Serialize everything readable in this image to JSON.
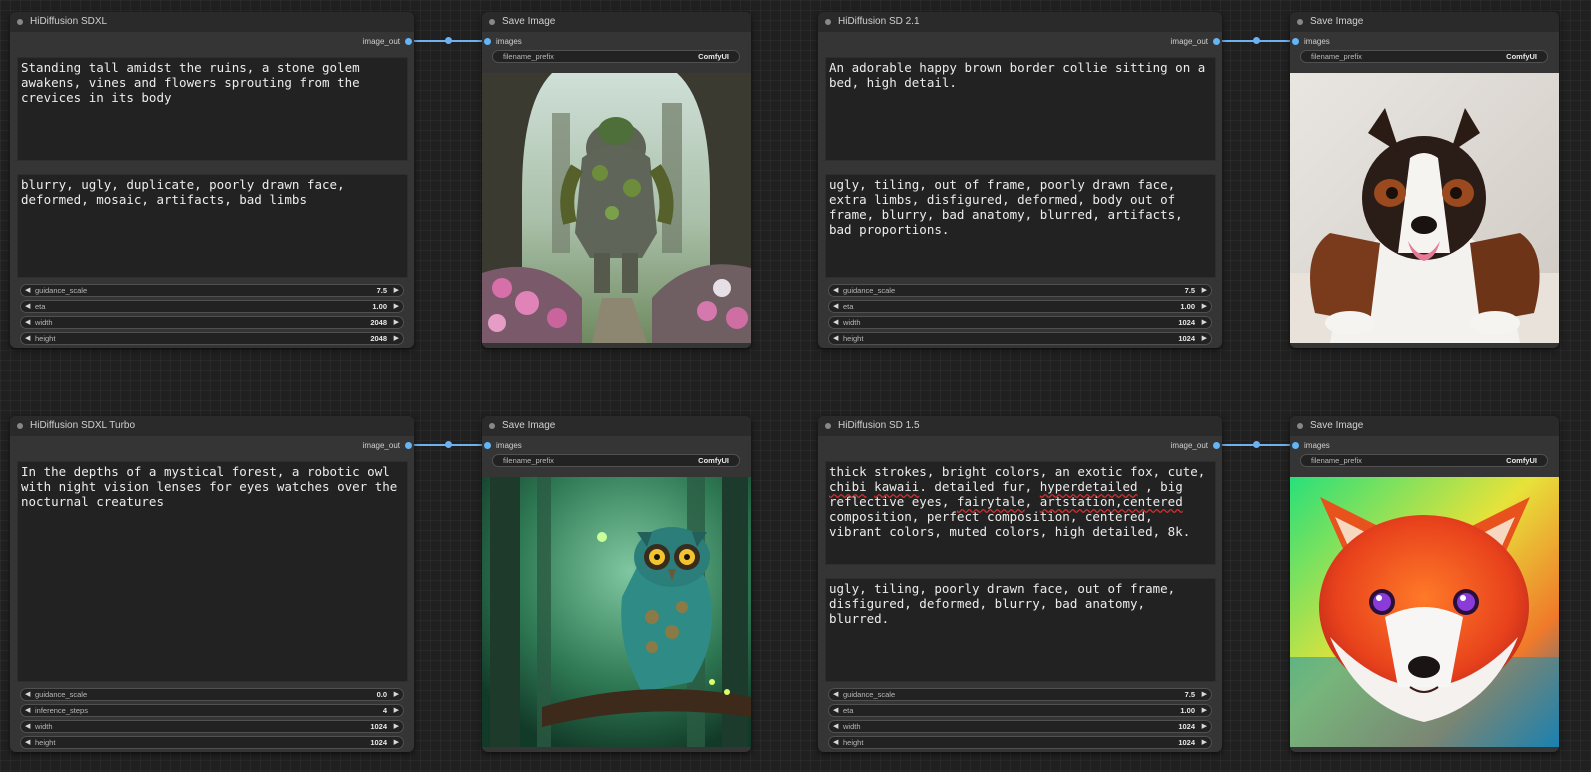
{
  "nodes": {
    "sdxl": {
      "title": "HiDiffusion SDXL",
      "output": "image_out",
      "positive": "Standing tall amidst the ruins, a stone golem awakens, vines and flowers sprouting from the crevices in its body",
      "negative": "blurry, ugly, duplicate, poorly drawn face, deformed, mosaic, artifacts, bad limbs",
      "widgets": [
        {
          "name": "guidance_scale",
          "value": "7.5"
        },
        {
          "name": "eta",
          "value": "1.00"
        },
        {
          "name": "width",
          "value": "2048"
        },
        {
          "name": "height",
          "value": "2048"
        }
      ]
    },
    "sd21": {
      "title": "HiDiffusion SD 2.1",
      "output": "image_out",
      "positive": "An adorable happy brown border collie sitting on a bed, high detail.",
      "negative": "ugly, tiling, out of frame, poorly drawn face, extra limbs, disfigured, deformed, body out of frame, blurry, bad anatomy, blurred, artifacts, bad proportions.",
      "widgets": [
        {
          "name": "guidance_scale",
          "value": "7.5"
        },
        {
          "name": "eta",
          "value": "1.00"
        },
        {
          "name": "width",
          "value": "1024"
        },
        {
          "name": "height",
          "value": "1024"
        }
      ]
    },
    "sdxl_turbo": {
      "title": "HiDiffusion SDXL Turbo",
      "output": "image_out",
      "positive": "In the depths of a mystical forest, a robotic owl with night vision lenses for eyes watches over the nocturnal creatures",
      "widgets": [
        {
          "name": "guidance_scale",
          "value": "0.0"
        },
        {
          "name": "inference_steps",
          "value": "4"
        },
        {
          "name": "width",
          "value": "1024"
        },
        {
          "name": "height",
          "value": "1024"
        }
      ]
    },
    "sd15": {
      "title": "HiDiffusion SD 1.5",
      "output": "image_out",
      "positive_parts": [
        "thick strokes, bright colors, an exotic fox, cute, ",
        "chibi",
        " ",
        "kawaii",
        ". detailed fur, ",
        "hyperdetailed",
        " , big reflective eyes, ",
        "fairytale",
        ", ",
        "artstation,centered",
        " composition, perfect composition, centered, vibrant colors, muted colors, high detailed, 8k."
      ],
      "negative": "ugly, tiling, poorly drawn face, out of frame, disfigured, deformed, blurry, bad anatomy, blurred.",
      "widgets": [
        {
          "name": "guidance_scale",
          "value": "7.5"
        },
        {
          "name": "eta",
          "value": "1.00"
        },
        {
          "name": "width",
          "value": "1024"
        },
        {
          "name": "height",
          "value": "1024"
        }
      ]
    }
  },
  "save_nodes": {
    "title": "Save Image",
    "input": "images",
    "prefix_name": "filename_prefix",
    "prefix_value": "ComfyUI"
  },
  "images": {
    "golem": "stone golem covered in vines standing among ruins with pink flowers",
    "collie": "brown and white border collie lying on a bed",
    "owl": "robotic teal owl perched on a branch in a green forest",
    "fox": "colorful red fox portrait with purple eyes"
  },
  "colors": {
    "wire": "#6fb0ee",
    "node_bg": "#353535",
    "canvas": "#202020"
  }
}
